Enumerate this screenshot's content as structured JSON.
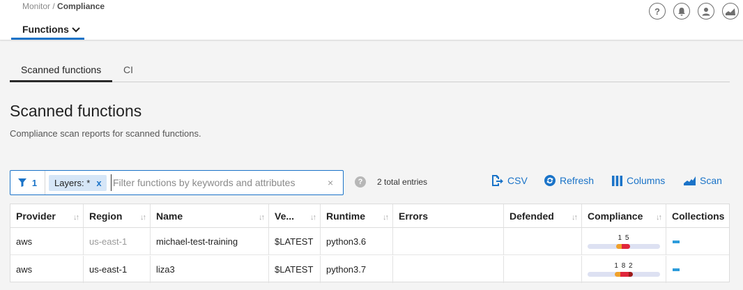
{
  "breadcrumb": {
    "parent": "Monitor",
    "separator": " / ",
    "current": "Compliance"
  },
  "nav": {
    "dropdown_label": "Functions",
    "dropdown_icon": "chevron-down-icon"
  },
  "top_icons": [
    "help-icon",
    "bell-icon",
    "user-icon",
    "chart-icon"
  ],
  "tabs": [
    {
      "label": "Scanned functions",
      "active": true
    },
    {
      "label": "CI",
      "active": false
    }
  ],
  "page": {
    "title": "Scanned functions",
    "subtitle": "Compliance scan reports for scanned functions."
  },
  "filter": {
    "count": "1",
    "chip": {
      "key": "Layers:",
      "value": "*",
      "remove": "x"
    },
    "placeholder": "Filter functions by keywords and attributes",
    "clear": "×"
  },
  "entries": {
    "help": "?",
    "text": "2 total entries"
  },
  "actions": [
    {
      "label": "CSV",
      "icon": "export-icon"
    },
    {
      "label": "Refresh",
      "icon": "refresh-icon"
    },
    {
      "label": "Columns",
      "icon": "columns-icon"
    },
    {
      "label": "Scan",
      "icon": "scan-chart-icon"
    }
  ],
  "table": {
    "headers": [
      "Provider",
      "Region",
      "Name",
      "Ve...",
      "Runtime",
      "Errors",
      "Defended",
      "Compliance",
      "Collections"
    ],
    "rows": [
      {
        "provider": "aws",
        "region": "us-east-1",
        "name": "michael-test-training",
        "version": "$LATEST",
        "runtime": "python3.6",
        "errors": "",
        "defended": "",
        "compliance": "1 5",
        "compliance_counts": {
          "high": 1,
          "critical": 5
        }
      },
      {
        "provider": "aws",
        "region": "us-east-1",
        "name": "liza3",
        "version": "$LATEST",
        "runtime": "python3.7",
        "errors": "",
        "defended": "",
        "compliance": "1 8 2",
        "compliance_counts": {
          "high": 1,
          "critical": 8,
          "severe": 2
        }
      }
    ]
  },
  "colors": {
    "accent": "#1a73c8",
    "chip_bg": "#d6e6f7",
    "high": "#f0a12b",
    "critical": "#e0263b",
    "severe": "#9e1b1b",
    "collection": "#2d9cdb"
  }
}
